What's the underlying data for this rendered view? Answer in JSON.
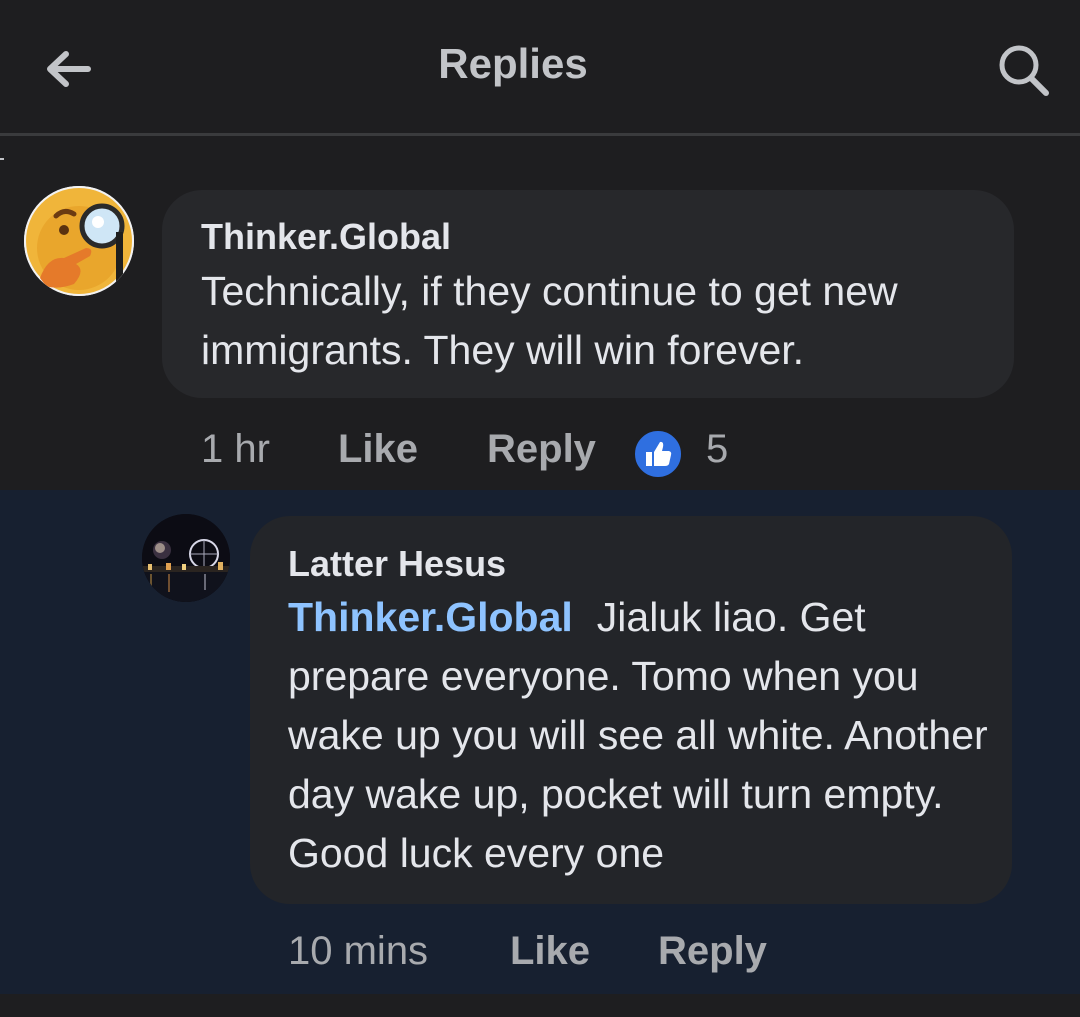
{
  "header": {
    "title": "Replies",
    "back_icon": "arrow-left-icon",
    "search_icon": "search-icon"
  },
  "comment": {
    "author": "Thinker.Global",
    "text": "Technically, if they continue to get new immigrants. They will win forever.",
    "time": "1 hr",
    "like_label": "Like",
    "reply_label": "Reply",
    "reaction_icon": "thumbs-up-icon",
    "reaction_count": "5"
  },
  "reply": {
    "author": "Latter Hesus",
    "mention": "Thinker.Global",
    "text": "Jialuk liao. Get prepare everyone. Tomo when you wake up you will see all white. Another day wake up, pocket will turn empty. Good luck every one",
    "time": "10 mins",
    "like_label": "Like",
    "reply_label": "Reply"
  },
  "colors": {
    "background": "#1e1e20",
    "bubble": "#27282b",
    "highlight_row": "#172030",
    "mention": "#8ec3ff",
    "like_blue": "#2f6fe0"
  }
}
